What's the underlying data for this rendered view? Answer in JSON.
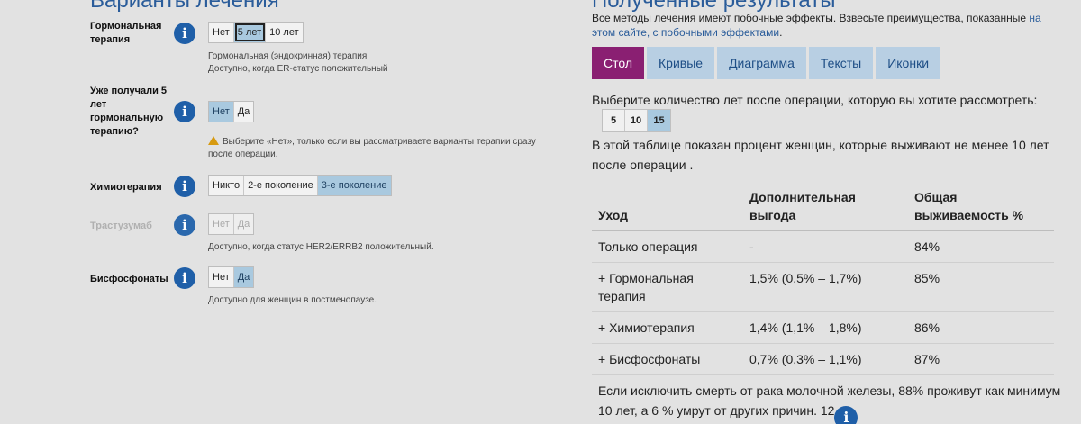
{
  "left": {
    "heading": "Варианты лечения",
    "rows": [
      {
        "label": "Гормональная терапия",
        "options": [
          "Нет",
          "5 лет",
          "10 лет"
        ],
        "help": [
          "Гормональная (эндокринная) терапия",
          "Доступно, когда ER-статус положительный"
        ]
      },
      {
        "label": "Уже получали 5 лет гормональную терапию?",
        "options": [
          "Нет",
          "Да"
        ],
        "help": [
          "Выберите «Нет», только если вы рассматриваете варианты терапии сразу",
          "после операции."
        ]
      },
      {
        "label": "Химиотерапия",
        "options": [
          "Никто",
          "2-е поколение",
          "3-е поколение"
        ]
      },
      {
        "label": "Трастузумаб",
        "options": [
          "Нет",
          "Да"
        ],
        "help": [
          "Доступно, когда статус HER2/ERRB2 положительный."
        ]
      },
      {
        "label": "Бисфосфонаты",
        "options": [
          "Нет",
          "Да"
        ],
        "help": [
          "Доступно для женщин в постменопаузе."
        ]
      }
    ]
  },
  "right": {
    "heading": "Полученные результаты",
    "intro_text": "Все методы лечения имеют побочные эффекты. Взвесьте преимущества, показанные",
    "intro_link": "на этом сайте, с побочными эффектами",
    "intro_end": ".",
    "tabs": [
      "Стол",
      "Кривые",
      "Диаграмма",
      "Тексты",
      "Иконки"
    ],
    "years_prompt": "Выберите количество лет после операции, которую вы хотите рассмотреть:",
    "years": [
      "5",
      "10",
      "15"
    ],
    "table_desc": "В этой таблице показан процент женщин, которые выживают не менее 10 лет после операции .",
    "table": {
      "headers": [
        "Уход",
        "Дополнительная выгода",
        "Общая выживаемость %"
      ],
      "rows": [
        [
          "Только операция",
          "-",
          "84%"
        ],
        [
          "+ Гормональная терапия",
          "1,5% (0,5% – 1,7%)",
          "85%"
        ],
        [
          "+ Химиотерапия",
          "1,4% (1,1% – 1,8%)",
          "86%"
        ],
        [
          "+ Бисфосфонаты",
          "0,7% (0,3% – 1,1%)",
          "87%"
        ]
      ]
    },
    "footer": "Если исключить смерть от рака молочной железы, 88% проживут как минимум 10 лет, а 6 % умрут от других причин.",
    "footer_num": "12"
  },
  "icons": {
    "info": "i"
  }
}
